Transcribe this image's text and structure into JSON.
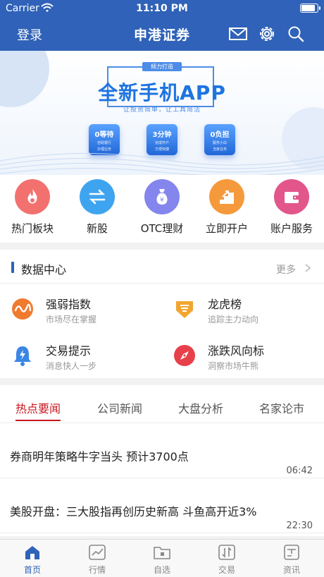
{
  "status_bar": {
    "carrier": "Carrier",
    "time": "11:10 PM",
    "battery_fraction": 0.9
  },
  "navbar": {
    "login_label": "登录",
    "title": "申港证券",
    "icons": [
      "mail-icon",
      "gear-icon",
      "search-icon"
    ]
  },
  "banner": {
    "tagline": "倾力打造",
    "headline": "全新手机APP",
    "subline": "让投资简单，让工具简洁",
    "tiles": [
      {
        "value": "0等待",
        "sub1": "自助银行",
        "sub2": "办理业务"
      },
      {
        "value": "3分钟",
        "sub1": "完成开户",
        "sub2": "方便快捷"
      },
      {
        "value": "0负担",
        "sub1": "服务小白",
        "sub2": "当家业务"
      }
    ],
    "colors": {
      "headline": "#1e74e0",
      "tile": "#2267d8"
    }
  },
  "shortcuts": [
    {
      "label": "热门板块",
      "icon": "flame-icon",
      "color": "#f2716f"
    },
    {
      "label": "新股",
      "icon": "exchange-arrows-icon",
      "color": "#3fa4f0"
    },
    {
      "label": "OTC理财",
      "icon": "money-bag-icon",
      "color": "#8585ee"
    },
    {
      "label": "立即开户",
      "icon": "stairs-icon",
      "color": "#f59a3c"
    },
    {
      "label": "账户服务",
      "icon": "wallet-icon",
      "color": "#e2568b"
    }
  ],
  "data_center": {
    "title": "数据中心",
    "more_label": "更多",
    "items": [
      {
        "name": "强弱指数",
        "desc": "市场尽在掌握",
        "icon": "wave-chart-icon"
      },
      {
        "name": "龙虎榜",
        "desc": "追踪主力动向",
        "icon": "rank-badge-icon"
      },
      {
        "name": "交易提示",
        "desc": "消息快人一步",
        "icon": "bell-icon"
      },
      {
        "name": "涨跌风向标",
        "desc": "洞察市场牛熊",
        "icon": "compass-icon"
      }
    ]
  },
  "news_tabs": [
    {
      "label": "热点要闻",
      "active": true
    },
    {
      "label": "公司新闻",
      "active": false
    },
    {
      "label": "大盘分析",
      "active": false
    },
    {
      "label": "名家论市",
      "active": false
    }
  ],
  "news": [
    {
      "headline": "券商明年策略牛字当头 预计3700点",
      "time": "06:42"
    },
    {
      "headline": "美股开盘：三大股指再创历史新高 斗鱼高开近3%",
      "time": "22:30"
    }
  ],
  "tabbar": [
    {
      "label": "首页",
      "icon": "home-icon",
      "active": true
    },
    {
      "label": "行情",
      "icon": "chart-icon",
      "active": false
    },
    {
      "label": "自选",
      "icon": "folder-icon",
      "active": false
    },
    {
      "label": "交易",
      "icon": "trade-icon",
      "active": false
    },
    {
      "label": "资讯",
      "icon": "news-icon",
      "active": false
    }
  ],
  "colors": {
    "brand": "#2f62b8",
    "active_tab": "#c8161e"
  }
}
